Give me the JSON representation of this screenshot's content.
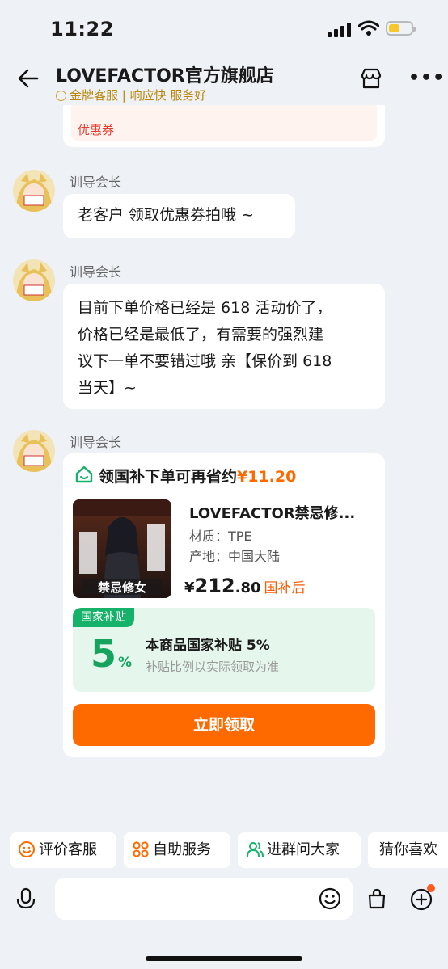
{
  "status_bar": {
    "time": "11:22"
  },
  "header": {
    "shop_name": "LOVEFACTOR官方旗舰店",
    "subtitle": "金牌客服 | 响应快 服务好"
  },
  "coupon_bubble": {
    "label": "优惠券"
  },
  "messages": [
    {
      "sender": "训导会长",
      "text": "老客户 领取优惠券拍哦 ~"
    },
    {
      "sender": "训导会长",
      "lines": [
        "目前下单价格已经是 618 活动价了，",
        "价格已经是最低了，有需要的强烈建",
        "议下一单不要错过哦 亲【保价到 618",
        "当天】~"
      ]
    },
    {
      "sender": "训导会长"
    }
  ],
  "subsidy_card": {
    "title": "领国补下单可再省约",
    "amount": "¥11.20",
    "product_name": "LOVEFACTOR禁忌修...",
    "attr_material": "材质：TPE",
    "attr_origin": "产地：中国大陆",
    "price_symbol": "¥",
    "price_int": "212",
    "price_dec": ".80",
    "price_tag": "国补后",
    "subsidy_label": "国家补贴",
    "subsidy_percent": "5",
    "subsidy_percent_unit": "%",
    "subsidy_title": "本商品国家补贴 5%",
    "subsidy_note": "补贴比例以实际领取为准",
    "claim_button": "立即领取",
    "product_image_text": "禁忌修女"
  },
  "quick_actions": [
    {
      "label": "评价客服"
    },
    {
      "label": "自助服务"
    },
    {
      "label": "进群问大家"
    },
    {
      "label": "猜你喜欢"
    }
  ],
  "input": {
    "placeholder": ""
  },
  "colors": {
    "accent": "#ff6a00",
    "green": "#17b26a",
    "gold": "#b8860b"
  }
}
